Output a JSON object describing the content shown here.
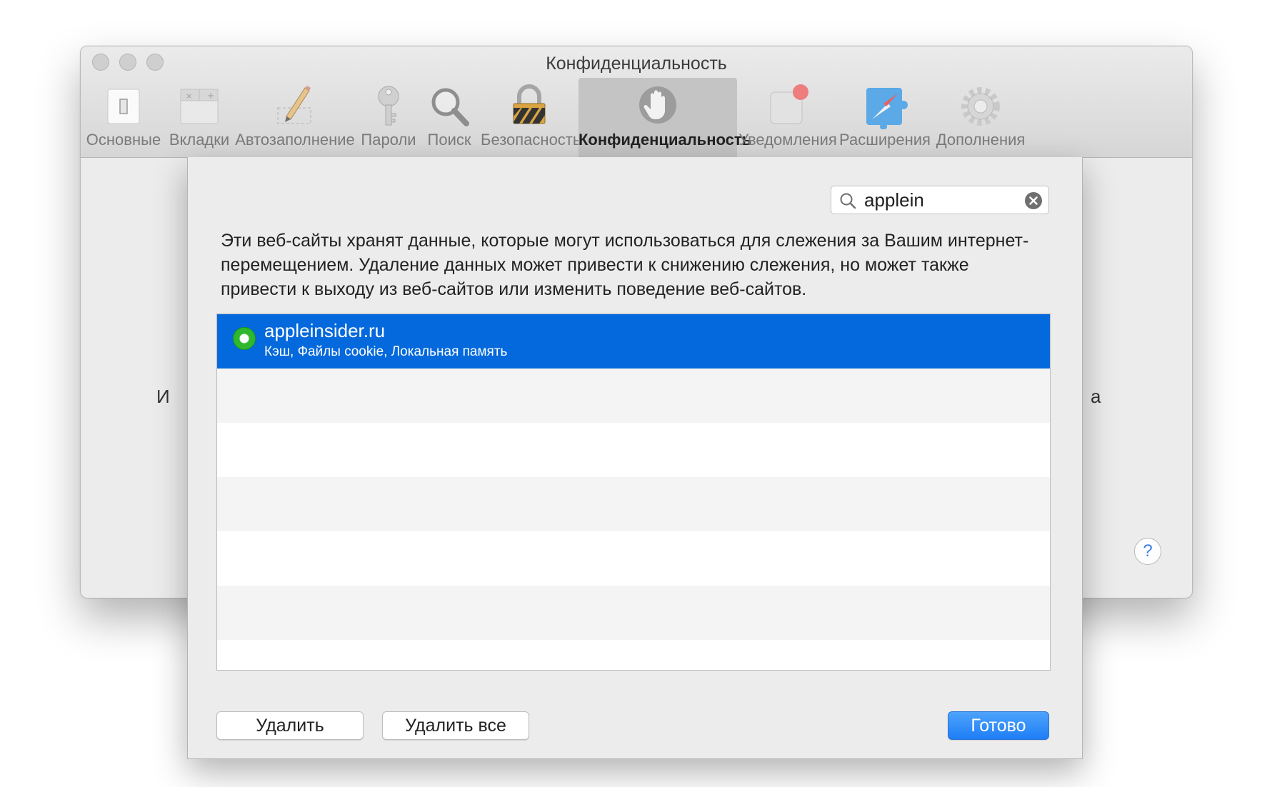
{
  "window": {
    "title": "Конфиденциальность"
  },
  "toolbar": {
    "items": [
      {
        "label": "Основные",
        "icon": "general-switch-icon"
      },
      {
        "label": "Вкладки",
        "icon": "tabs-icon"
      },
      {
        "label": "Автозаполнение",
        "icon": "pencil-icon"
      },
      {
        "label": "Пароли",
        "icon": "key-icon"
      },
      {
        "label": "Поиск",
        "icon": "magnifier-icon"
      },
      {
        "label": "Безопасность",
        "icon": "padlock-icon"
      },
      {
        "label": "Конфиденциальность",
        "icon": "hand-icon",
        "selected": true
      },
      {
        "label": "Уведомления",
        "icon": "notifications-icon"
      },
      {
        "label": "Расширения",
        "icon": "extensions-puzzle-icon"
      },
      {
        "label": "Дополнения",
        "icon": "gear-icon"
      }
    ]
  },
  "background": {
    "left_partial": "И",
    "right_partial": "а",
    "help": "?"
  },
  "sheet": {
    "search_value": "applein",
    "description": "Эти веб-сайты хранят данные, которые могут использоваться для слежения за Вашим интернет-перемещением. Удаление данных может привести к снижению слежения, но может также привести к выходу из веб-сайтов или изменить поведение веб-сайтов.",
    "sites": [
      {
        "name": "appleinsider.ru",
        "details": "Кэш, Файлы cookie, Локальная память",
        "selected": true
      }
    ],
    "buttons": {
      "remove": "Удалить",
      "remove_all": "Удалить все",
      "done": "Готово"
    }
  },
  "colors": {
    "selection": "#0469dc",
    "primary_button": "#1f7ef6",
    "status_dot": "#2eb82e"
  }
}
